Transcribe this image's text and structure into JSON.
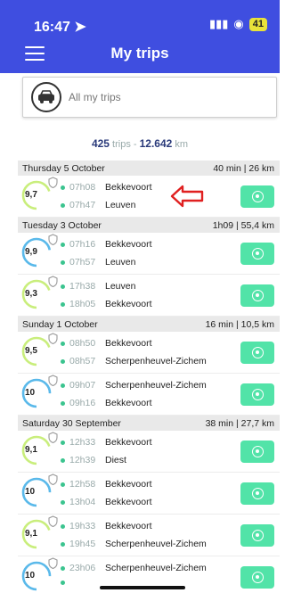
{
  "status": {
    "time": "16:47",
    "battery": "41"
  },
  "header": {
    "title": "My trips"
  },
  "filter": {
    "label": "All my trips"
  },
  "summary": {
    "count": "425",
    "count_unit": "trips",
    "distance": "12.642",
    "distance_unit": "km"
  },
  "colors": {
    "header": "#3f4ee0",
    "accent": "#52e3a8",
    "score_green": "#c9ee7c",
    "score_blue": "#5ab9ea"
  },
  "days": [
    {
      "label": "Thursday 5 October",
      "summary": "40 min | 26 km",
      "trips": [
        {
          "score": "9,7",
          "ring": "green",
          "progress": 0.7,
          "start_time": "07h08",
          "start_place": "Bekkevoort",
          "end_time": "07h47",
          "end_place": "Leuven",
          "highlighted": true
        }
      ]
    },
    {
      "label": "Tuesday 3 October",
      "summary": "1h09 | 55,4 km",
      "trips": [
        {
          "score": "9,9",
          "ring": "blue",
          "progress": 0.72,
          "start_time": "07h16",
          "start_place": "Bekkevoort",
          "end_time": "07h57",
          "end_place": "Leuven"
        },
        {
          "score": "9,3",
          "ring": "green",
          "progress": 0.7,
          "start_time": "17h38",
          "start_place": "Leuven",
          "end_time": "18h05",
          "end_place": "Bekkevoort"
        }
      ]
    },
    {
      "label": "Sunday 1 October",
      "summary": "16 min | 10,5 km",
      "trips": [
        {
          "score": "9,5",
          "ring": "green",
          "progress": 0.7,
          "start_time": "08h50",
          "start_place": "Bekkevoort",
          "end_time": "08h57",
          "end_place": "Scherpenheuvel-Zichem"
        },
        {
          "score": "10",
          "ring": "blue",
          "progress": 0.75,
          "start_time": "09h07",
          "start_place": "Scherpenheuvel-Zichem",
          "end_time": "09h16",
          "end_place": "Bekkevoort"
        }
      ]
    },
    {
      "label": "Saturday 30 September",
      "summary": "38 min | 27,7 km",
      "trips": [
        {
          "score": "9,1",
          "ring": "green",
          "progress": 0.7,
          "start_time": "12h33",
          "start_place": "Bekkevoort",
          "end_time": "12h39",
          "end_place": "Diest"
        },
        {
          "score": "10",
          "ring": "blue",
          "progress": 0.75,
          "start_time": "12h58",
          "start_place": "Bekkevoort",
          "end_time": "13h04",
          "end_place": "Bekkevoort"
        },
        {
          "score": "9,1",
          "ring": "green",
          "progress": 0.7,
          "start_time": "19h33",
          "start_place": "Bekkevoort",
          "end_time": "19h45",
          "end_place": "Scherpenheuvel-Zichem"
        },
        {
          "score": "10",
          "ring": "blue",
          "progress": 0.75,
          "start_time": "23h06",
          "start_place": "Scherpenheuvel-Zichem",
          "end_time": "",
          "end_place": ""
        }
      ]
    }
  ]
}
